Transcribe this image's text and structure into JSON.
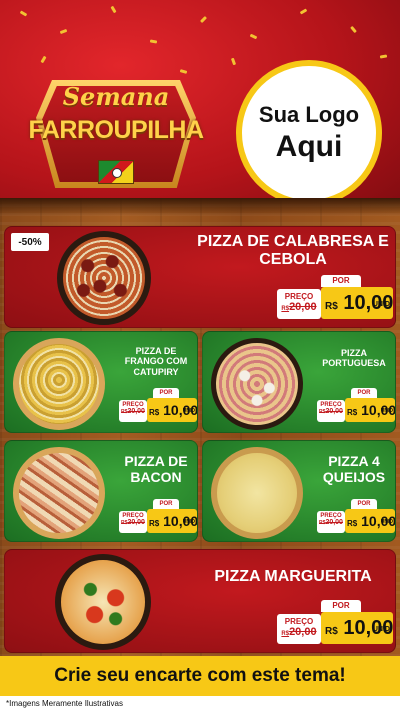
{
  "header": {
    "badge_line1": "Semana",
    "badge_line2": "FARROUPILHA",
    "logo_line1": "Sua Logo",
    "logo_line2": "Aqui"
  },
  "discount_badge": "-50%",
  "products": [
    {
      "name": "PIZZA DE CALABRESA E CEBOLA",
      "por": "POR",
      "preco_label": "PREÇO",
      "old_prefix": "R$",
      "old_price": "20,00",
      "new_prefix": "R$",
      "new_price": "10,00",
      "unit": "UNID"
    },
    {
      "name": "PIZZA DE FRANGO COM CATUPIRY",
      "por": "POR",
      "preco_label": "PREÇO",
      "old_prefix": "R$",
      "old_price": "20,00",
      "new_prefix": "R$",
      "new_price": "10,00",
      "unit": "UNID"
    },
    {
      "name": "PIZZA PORTUGUESA",
      "por": "POR",
      "preco_label": "PREÇO",
      "old_prefix": "R$",
      "old_price": "20,00",
      "new_prefix": "R$",
      "new_price": "10,00",
      "unit": "UNID"
    },
    {
      "name": "PIZZA DE BACON",
      "por": "POR",
      "preco_label": "PREÇO",
      "old_prefix": "R$",
      "old_price": "20,00",
      "new_prefix": "R$",
      "new_price": "10,00",
      "unit": "UNID"
    },
    {
      "name": "PIZZA 4 QUEIJOS",
      "por": "POR",
      "preco_label": "PREÇO",
      "old_prefix": "R$",
      "old_price": "20,00",
      "new_prefix": "R$",
      "new_price": "10,00",
      "unit": "UNID"
    },
    {
      "name": "PIZZA MARGUERITA",
      "por": "POR",
      "preco_label": "PREÇO",
      "old_prefix": "R$",
      "old_price": "20,00",
      "new_prefix": "R$",
      "new_price": "10,00",
      "unit": "UNID"
    }
  ],
  "banner": "Crie seu encarte com este tema!",
  "footer_note": "*Imagens Meramente Ilustrativas",
  "colors": {
    "red": "#c2191e",
    "green": "#2e8b2e",
    "yellow": "#f7c816",
    "wood": "#9a5520"
  }
}
